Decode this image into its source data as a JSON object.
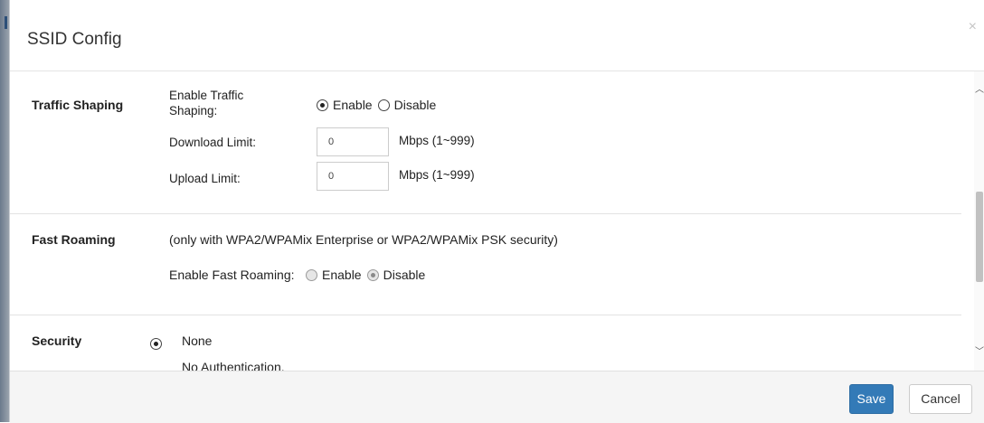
{
  "modal": {
    "title": "SSID Config",
    "close_glyph": "×"
  },
  "traffic_shaping": {
    "section_label": "Traffic Shaping",
    "enable_label_line1": "Enable Traffic",
    "enable_label_line2": "Shaping:",
    "enable_option": "Enable",
    "disable_option": "Disable",
    "selected": "Enable",
    "download_label": "Download Limit:",
    "download_value": "0",
    "download_unit": "Mbps (1~999)",
    "upload_label": "Upload Limit:",
    "upload_value": "0",
    "upload_unit": "Mbps (1~999)"
  },
  "fast_roaming": {
    "section_label": "Fast Roaming",
    "note": "(only with WPA2/WPAMix Enterprise or WPA2/WPAMix PSK security)",
    "enable_label": "Enable Fast Roaming:",
    "enable_option": "Enable",
    "disable_option": "Disable",
    "selected": "Disable"
  },
  "security": {
    "section_label": "Security",
    "option_name": "None",
    "option_description": "No Authentication.",
    "selected": "None"
  },
  "footer": {
    "save_label": "Save",
    "cancel_label": "Cancel"
  },
  "colors": {
    "primary_button": "#337ab7",
    "footer_bg": "#f5f5f5"
  },
  "icons": {
    "close": "close-icon",
    "scroll_up": "chevron-up-icon",
    "scroll_down": "chevron-down-icon"
  }
}
